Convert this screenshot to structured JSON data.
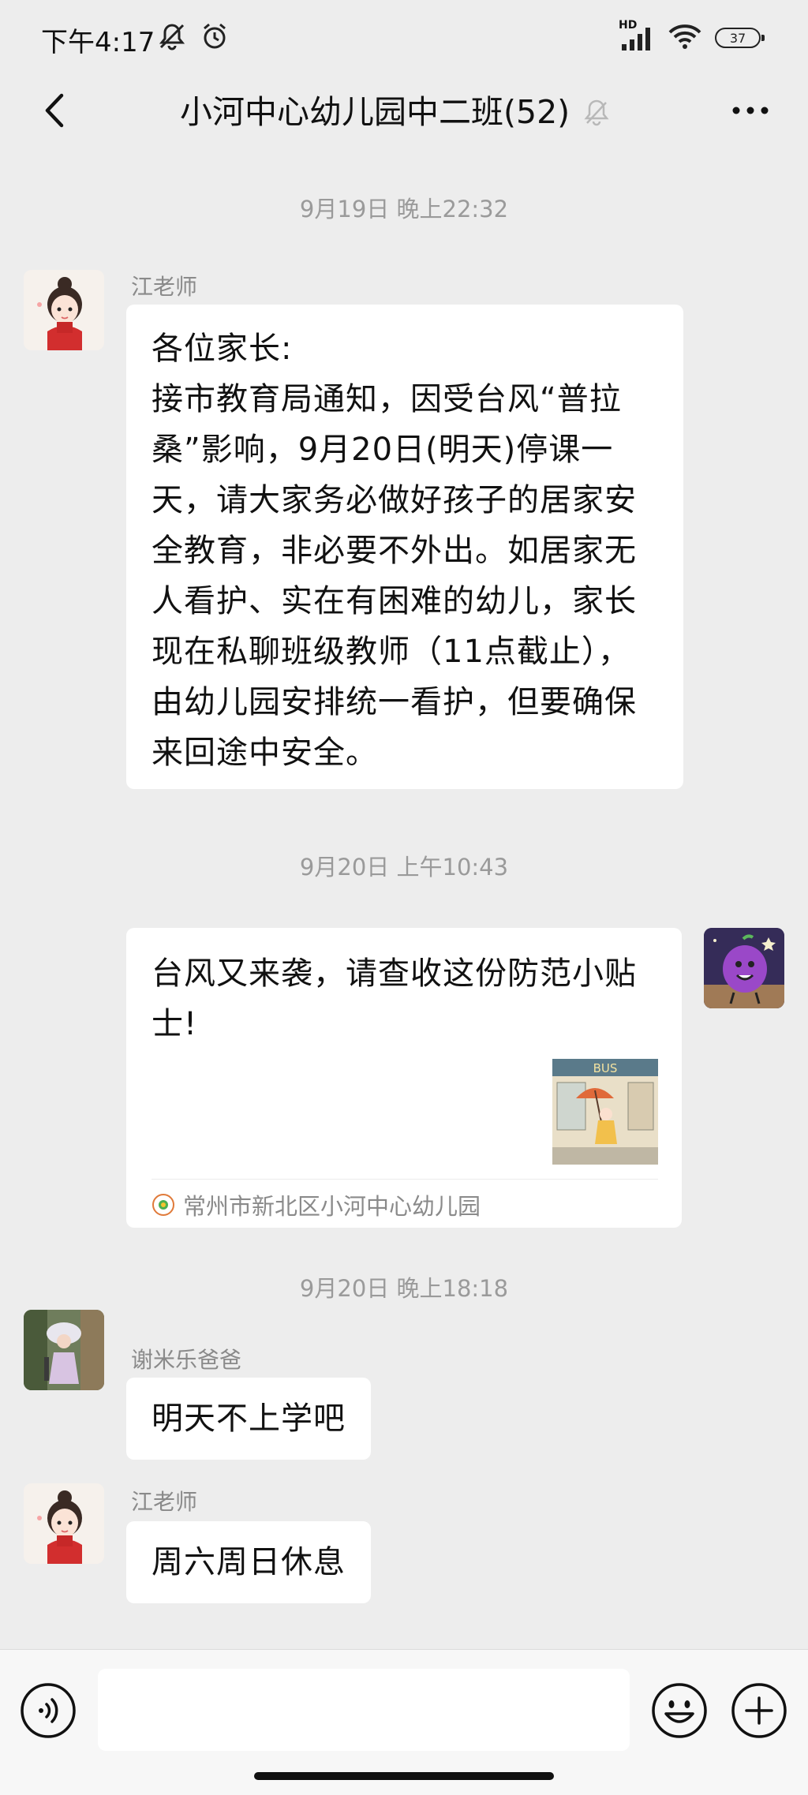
{
  "status_bar": {
    "time": "下午4:17",
    "network_label": "HD",
    "battery_level": "37",
    "icons": [
      "mute-icon",
      "alarm-icon",
      "signal-icon",
      "wifi-icon",
      "battery-icon"
    ]
  },
  "header": {
    "title": "小河中心幼儿园中二班(52)",
    "icons": [
      "back-arrow-icon",
      "bell-muted-icon",
      "more-dots-icon"
    ]
  },
  "messages": [
    {
      "timestamp": "9月19日 晚上22:32",
      "sender": "江老师",
      "text": "各位家长:\n接市教育局通知，因受台风“普拉桑”影响，9月20日(明天)停课一天，请大家务必做好孩子的居家安全教育，非必要不外出。如居家无人看护、实在有困难的幼儿，家长现在私聊班级教师（11点截止），由幼儿园安排统一看护，但要确保来回途中安全。"
    },
    {
      "timestamp": "9月20日 上午10:43",
      "link_title": "台风又来袭，请查收这份防范小贴士!",
      "thumb_text": "BUS",
      "source": "常州市新北区小河中心幼儿园"
    },
    {
      "timestamp": "9月20日 晚上18:18",
      "sender": "谢米乐爸爸",
      "text": "明天不上学吧"
    },
    {
      "sender": "江老师",
      "text": "周六周日休息"
    }
  ],
  "input_bar": {
    "placeholder": "",
    "icons": [
      "voice-icon",
      "emoji-icon",
      "plus-icon"
    ]
  },
  "colors": {
    "background": "#ededed",
    "bubble": "#ffffff",
    "timestamp_text": "#9a9a9a",
    "sender_text": "#8a8a8a"
  }
}
